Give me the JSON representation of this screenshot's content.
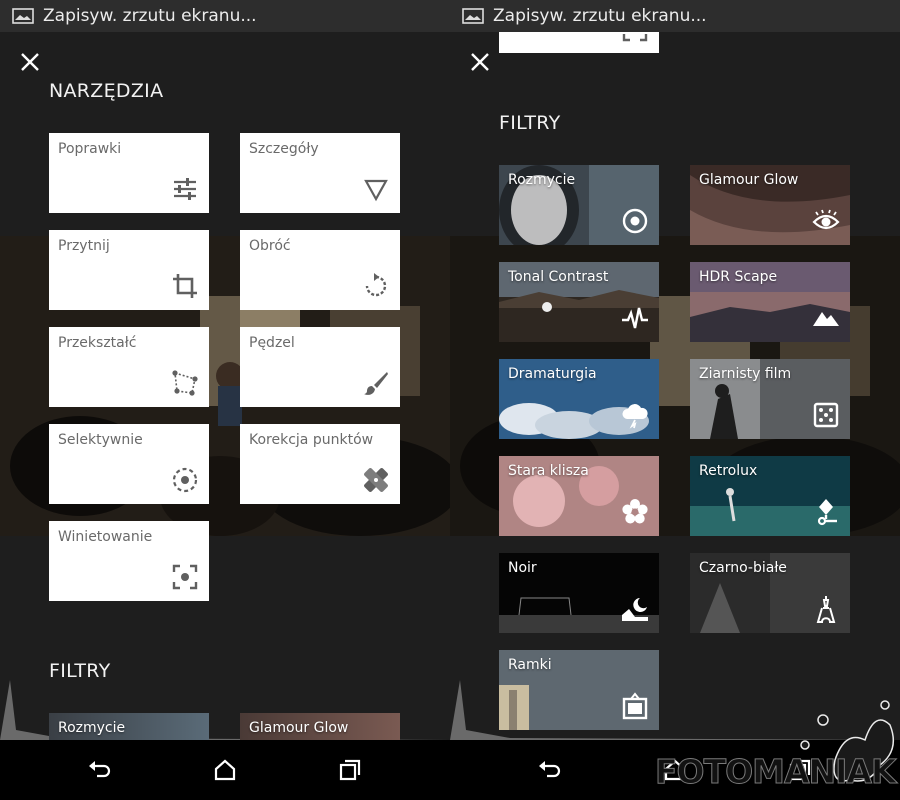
{
  "status_bar": {
    "text": "Zapisyw. zrzutu ekranu..."
  },
  "left": {
    "tools_title": "NARZĘDZIA",
    "tools": [
      {
        "label": "Poprawki",
        "icon": "sliders-icon"
      },
      {
        "label": "Szczegóły",
        "icon": "triangle-down-icon"
      },
      {
        "label": "Przytnij",
        "icon": "crop-icon"
      },
      {
        "label": "Obróć",
        "icon": "rotate-icon"
      },
      {
        "label": "Przekształć",
        "icon": "perspective-icon"
      },
      {
        "label": "Pędzel",
        "icon": "brush-icon"
      },
      {
        "label": "Selektywnie",
        "icon": "selective-target-icon"
      },
      {
        "label": "Korekcja punktów",
        "icon": "bandage-icon"
      },
      {
        "label": "Winietowanie",
        "icon": "vignette-focus-icon"
      }
    ],
    "filters_title": "FILTRY",
    "filters": [
      {
        "label": "Rozmycie"
      },
      {
        "label": "Glamour Glow"
      }
    ]
  },
  "right": {
    "filters_title": "FILTRY",
    "filters": [
      {
        "label": "Rozmycie",
        "icon": "focus-target-icon"
      },
      {
        "label": "Glamour Glow",
        "icon": "eye-icon"
      },
      {
        "label": "Tonal Contrast",
        "icon": "pulse-icon"
      },
      {
        "label": "HDR Scape",
        "icon": "mountains-icon"
      },
      {
        "label": "Dramaturgia",
        "icon": "storm-cloud-icon"
      },
      {
        "label": "Ziarnisty film",
        "icon": "dice-icon"
      },
      {
        "label": "Stara klisza",
        "icon": "flower-icon"
      },
      {
        "label": "Retrolux",
        "icon": "retro-pin-icon"
      },
      {
        "label": "Noir",
        "icon": "moon-landscape-icon"
      },
      {
        "label": "Czarno-białe",
        "icon": "eiffel-tower-icon"
      },
      {
        "label": "Ramki",
        "icon": "frame-icon"
      }
    ]
  },
  "watermark": "FOTOMANIAK",
  "colors": {
    "card_bg": "#ffffff",
    "card_text": "#6a6a6a",
    "icon_gray": "#606060",
    "status_bar": "#2d2d2d",
    "nav_bar": "#000000"
  }
}
